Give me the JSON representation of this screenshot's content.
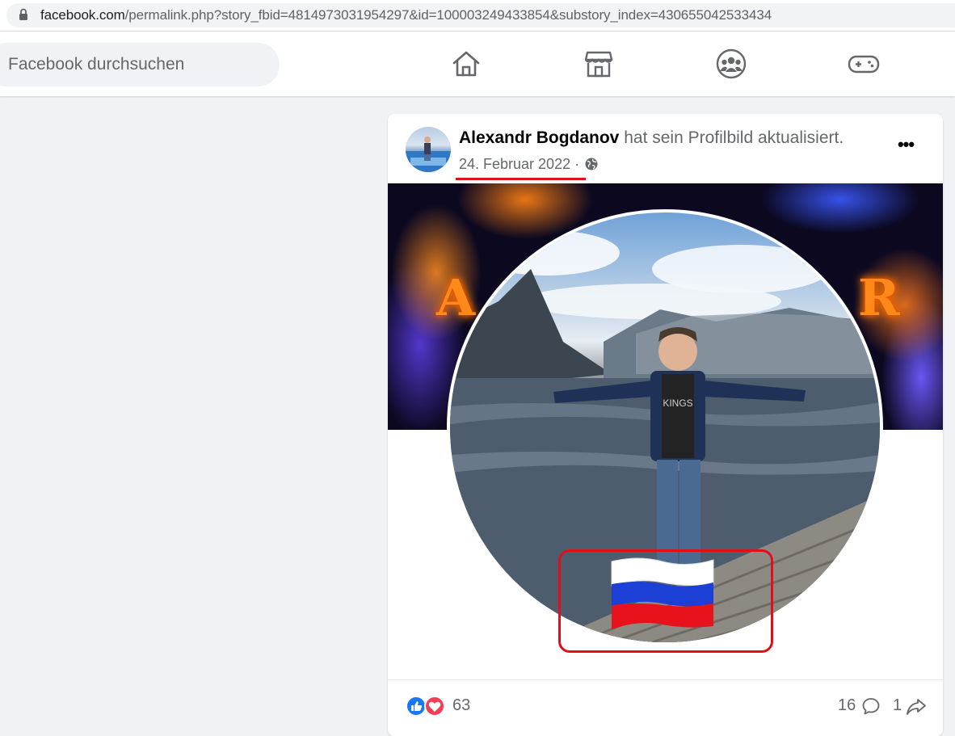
{
  "browser": {
    "url_domain": "facebook.com",
    "url_path": "/permalink.php?story_fbid=4814973031954297&id=100003249433854&substory_index=430655042533434"
  },
  "nav": {
    "search_placeholder": "Facebook durchsuchen",
    "icons": [
      "home-icon",
      "marketplace-icon",
      "groups-icon",
      "gaming-icon"
    ]
  },
  "post": {
    "author": "Alexandr Bogdanov",
    "action": " hat sein Profilbild aktualisiert.",
    "date": "24. Februar 2022",
    "separator": " · ",
    "privacy_icon": "globe-icon",
    "more_label": "•••",
    "cover_letters": [
      "A",
      "R"
    ],
    "reactions": [
      "like",
      "love"
    ],
    "reaction_count": "63",
    "comment_count": "16",
    "share_count": "1"
  },
  "colors": {
    "highlight": "#e0101a",
    "like_blue": "#1877f2",
    "love_red": "#f33e58"
  }
}
